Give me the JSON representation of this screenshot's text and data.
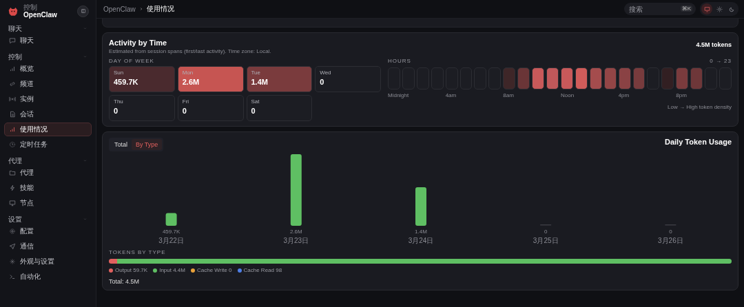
{
  "sidebar": {
    "brand": {
      "caption": "控制",
      "name": "OpenClaw"
    },
    "sections": [
      {
        "title": "聊天",
        "expanded": true,
        "items": [
          {
            "label": "聊天",
            "selected": false
          }
        ]
      },
      {
        "title": "控制",
        "expanded": true,
        "items": [
          {
            "label": "概览",
            "selected": false
          },
          {
            "label": "频道",
            "selected": false
          },
          {
            "label": "实例",
            "selected": false
          },
          {
            "label": "会话",
            "selected": false
          },
          {
            "label": "使用情况",
            "selected": true
          },
          {
            "label": "定时任务",
            "selected": false
          }
        ]
      },
      {
        "title": "代理",
        "expanded": true,
        "items": [
          {
            "label": "代理",
            "selected": false
          },
          {
            "label": "技能",
            "selected": false
          },
          {
            "label": "节点",
            "selected": false
          }
        ]
      },
      {
        "title": "设置",
        "expanded": true,
        "items": [
          {
            "label": "配置",
            "selected": false
          },
          {
            "label": "通信",
            "selected": false
          },
          {
            "label": "外观与设置",
            "selected": false
          },
          {
            "label": "自动化",
            "selected": false
          }
        ]
      }
    ]
  },
  "topbar": {
    "breadcrumb": [
      "OpenClaw",
      "使用情况"
    ],
    "search": {
      "placeholder": "搜索",
      "shortcut": "⌘K"
    },
    "theme_modes": [
      {
        "selected": true
      },
      {
        "selected": false
      },
      {
        "selected": false
      }
    ]
  },
  "activity": {
    "title": "Activity by Time",
    "subtitle": "Estimated from session spans (first/last activity). Time zone: Local.",
    "total": "4.5M tokens",
    "days_label": "DAY OF WEEK",
    "days": [
      {
        "name": "Sun",
        "value": "459.7K",
        "color": "#4a2a2e"
      },
      {
        "name": "Mon",
        "value": "2.6M",
        "color": "#c65552"
      },
      {
        "name": "Tue",
        "value": "1.4M",
        "color": "#7a3b3d"
      },
      {
        "name": "Wed",
        "value": "0",
        "color": "#1c1d23"
      },
      {
        "name": "Thu",
        "value": "0",
        "color": "#1c1d23"
      },
      {
        "name": "Fri",
        "value": "0",
        "color": "#1c1d23"
      },
      {
        "name": "Sat",
        "value": "0",
        "color": "#1c1d23"
      }
    ],
    "hours_label": "HOURS",
    "hours_range": "0 → 23",
    "hours": [
      {
        "color": "#1c1d23"
      },
      {
        "color": "#1c1d23"
      },
      {
        "color": "#1c1d23"
      },
      {
        "color": "#1c1d23"
      },
      {
        "color": "#1c1d23"
      },
      {
        "color": "#1c1d23"
      },
      {
        "color": "#1c1d23"
      },
      {
        "color": "#1c1d23"
      },
      {
        "color": "#3e2628"
      },
      {
        "color": "#6a3537"
      },
      {
        "color": "#c8595a"
      },
      {
        "color": "#c0585a"
      },
      {
        "color": "#c8595a"
      },
      {
        "color": "#d05c5a"
      },
      {
        "color": "#a44c4d"
      },
      {
        "color": "#934546"
      },
      {
        "color": "#8a4244"
      },
      {
        "color": "#783b3d"
      },
      {
        "color": "#1c1d23"
      },
      {
        "color": "#321f22"
      },
      {
        "color": "#7a3b3d"
      },
      {
        "color": "#6e3739"
      },
      {
        "color": "#1c1d23"
      },
      {
        "color": "#1c1d23"
      }
    ],
    "hour_labels": [
      "Midnight",
      "4am",
      "8am",
      "Noon",
      "4pm",
      "8pm"
    ],
    "legend": "Low → High token density"
  },
  "usage": {
    "tabs": [
      {
        "label": "Total",
        "selected": false
      },
      {
        "label": "By Type",
        "selected": true
      }
    ],
    "chart_data": {
      "type": "bar",
      "title": "Daily Token Usage",
      "categories": [
        "3月22日",
        "3月23日",
        "3月24日",
        "3月25日",
        "3月26日"
      ],
      "values": [
        459700,
        2600000,
        1400000,
        0,
        0
      ],
      "value_labels": [
        "459.7K",
        "2.6M",
        "1.4M",
        "0",
        "0"
      ]
    },
    "types_label": "TOKENS BY TYPE",
    "types": [
      {
        "name": "Output",
        "value": "59.7K",
        "color": "#e0605e",
        "level": 0.013
      },
      {
        "name": "Input",
        "value": "4.4M",
        "color": "#5fbf63",
        "level": 0.987
      },
      {
        "name": "Cache Write",
        "value": "0",
        "color": "#e8a13a",
        "level": 0
      },
      {
        "name": "Cache Read",
        "value": "98",
        "color": "#4f7fe6",
        "level": 0
      }
    ],
    "total": "Total: 4.5M"
  }
}
